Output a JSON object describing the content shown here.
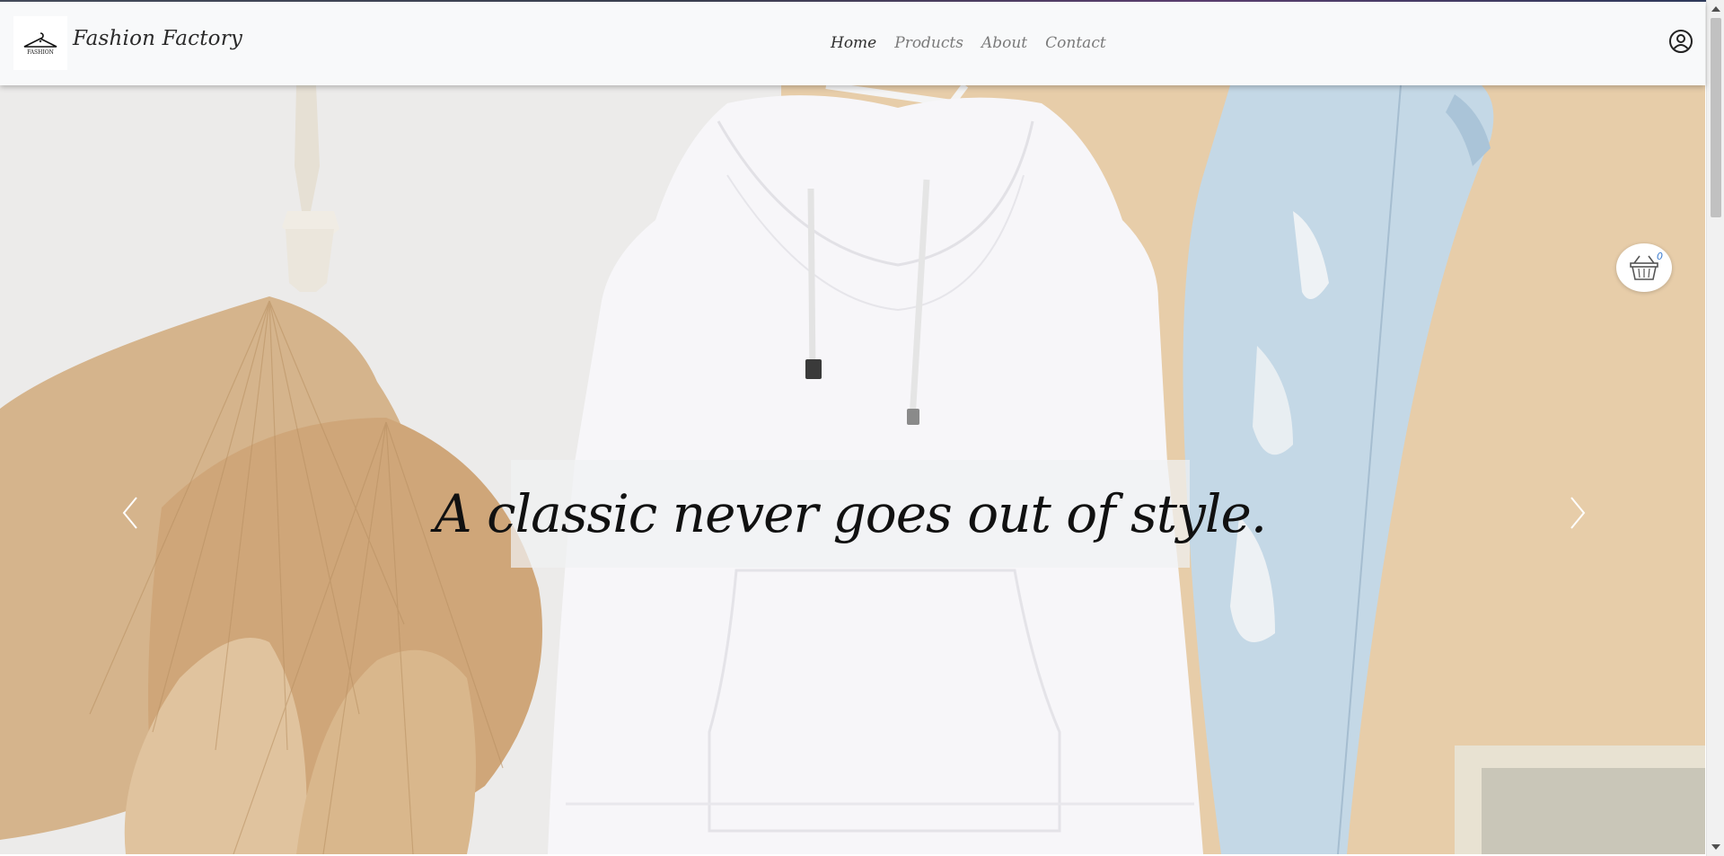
{
  "header": {
    "logo_text": "FASHION",
    "brand": "Fashion Factory",
    "nav": [
      {
        "label": "Home",
        "active": true
      },
      {
        "label": "Products",
        "active": false
      },
      {
        "label": "About",
        "active": false
      },
      {
        "label": "Contact",
        "active": false
      }
    ],
    "account_icon": "user-circle-icon"
  },
  "hero": {
    "caption": "A classic never goes out of style.",
    "prev_icon": "chevron-left-icon",
    "next_icon": "chevron-right-icon"
  },
  "cart": {
    "icon": "basket-icon",
    "count": "0"
  },
  "colors": {
    "header_bg": "#f8f9fa",
    "cart_count": "#3b7ccf"
  }
}
